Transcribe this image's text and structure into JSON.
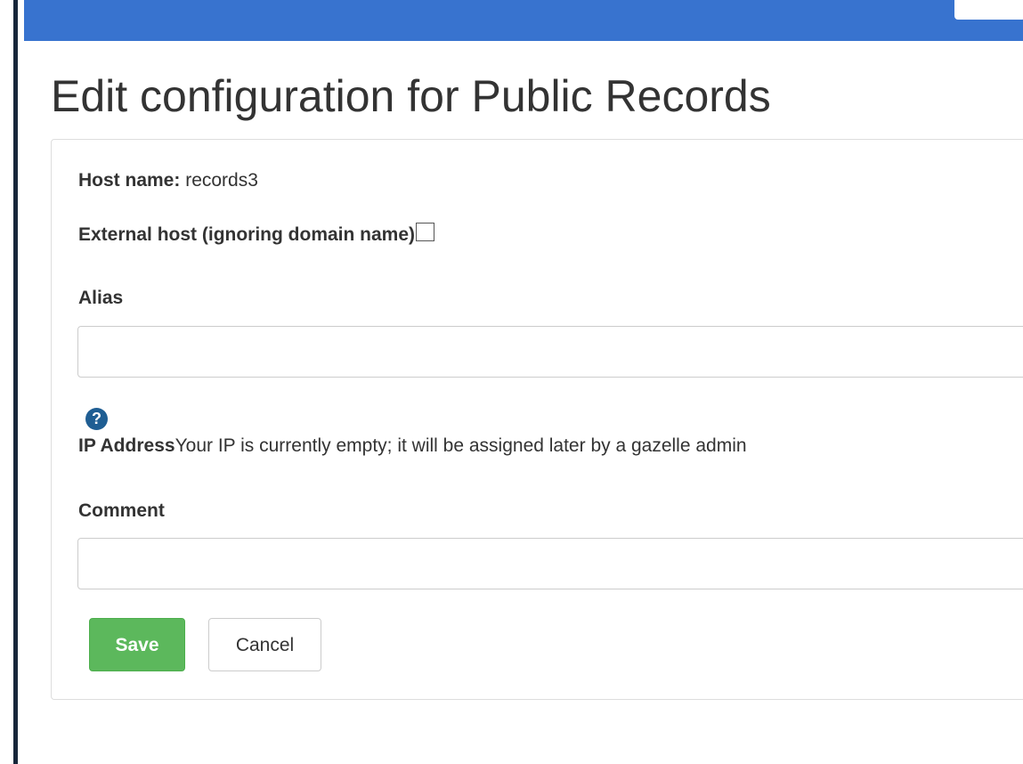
{
  "page": {
    "title": "Edit configuration for Public Records"
  },
  "host": {
    "label": "Host name:",
    "value": "records3"
  },
  "external": {
    "label": "External host (ignoring domain name)",
    "checked": false
  },
  "alias": {
    "label": "Alias",
    "value": ""
  },
  "ip": {
    "label": "IP Address",
    "text": "Your IP is currently empty; it will be assigned later by a gazelle admin",
    "help_icon": "question-circle-icon"
  },
  "comment": {
    "label": "Comment",
    "value": ""
  },
  "buttons": {
    "save": "Save",
    "cancel": "Cancel"
  },
  "colors": {
    "navbar": "#3873cf",
    "save": "#5cb85c",
    "help_icon": "#1f5e93"
  }
}
